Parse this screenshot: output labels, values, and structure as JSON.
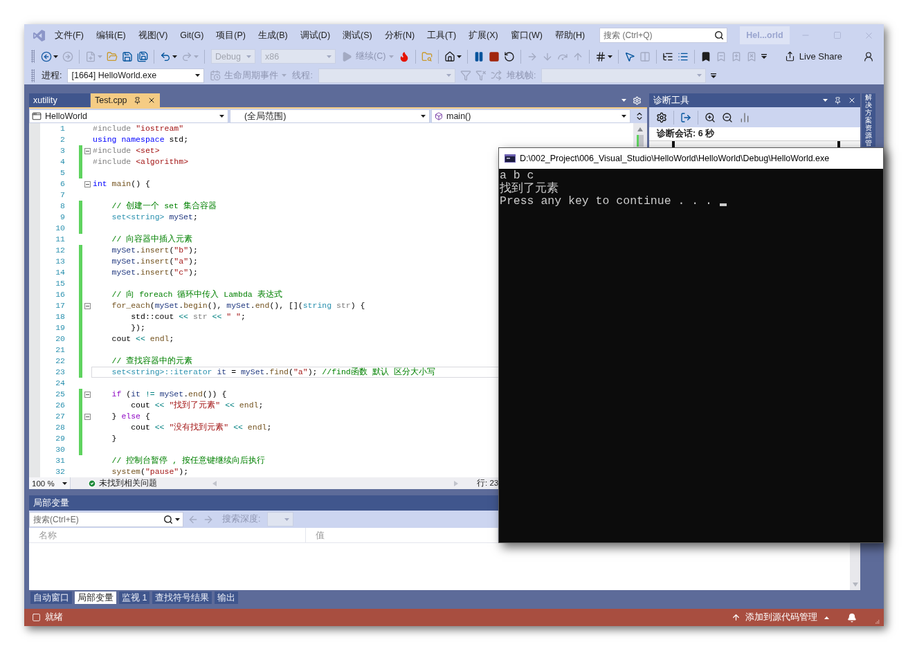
{
  "title_bar": {
    "menu": [
      "文件(F)",
      "编辑(E)",
      "视图(V)",
      "Git(G)",
      "项目(P)",
      "生成(B)",
      "调试(D)",
      "测试(S)",
      "分析(N)",
      "工具(T)",
      "扩展(X)",
      "窗口(W)",
      "帮助(H)"
    ],
    "search": {
      "placeholder": "搜索 (Ctrl+Q)"
    },
    "solution_name": "Hel...orld"
  },
  "toolbar_standard": {
    "groups": [
      {
        "items": [
          {
            "kind": "split",
            "disabled": false
          },
          {
            "kind": "icon",
            "disabled": true
          }
        ]
      },
      {
        "items": [
          {
            "kind": "split",
            "disabled": true
          },
          {
            "kind": "icon",
            "disabled": false
          },
          {
            "kind": "icon",
            "disabled": false
          },
          {
            "kind": "icon",
            "disabled": false
          }
        ]
      },
      {
        "items": [
          {
            "kind": "split",
            "disabled": false
          },
          {
            "kind": "split",
            "disabled": true
          }
        ]
      },
      {
        "items": [
          {
            "kind": "combo",
            "value": "Debug",
            "disabled": true
          },
          {
            "kind": "combo",
            "value": "x86",
            "disabled": true
          },
          {
            "kind": "labeled",
            "label": "继续(C)",
            "disabled": true
          },
          {
            "kind": "icon",
            "disabled": false
          }
        ]
      },
      {
        "items": [
          {
            "kind": "icon",
            "disabled": false
          }
        ]
      },
      {
        "items": [
          {
            "kind": "split",
            "disabled": false
          }
        ]
      },
      {
        "items": [
          {
            "kind": "icon",
            "disabled": false
          },
          {
            "kind": "icon",
            "disabled": false
          },
          {
            "kind": "icon",
            "disabled": false
          }
        ]
      },
      {
        "items": [
          {
            "kind": "icon",
            "disabled": true
          },
          {
            "kind": "icon",
            "disabled": true
          },
          {
            "kind": "icon",
            "disabled": true
          },
          {
            "kind": "icon",
            "disabled": true
          }
        ]
      },
      {
        "items": [
          {
            "kind": "split",
            "disabled": false
          }
        ]
      },
      {
        "items": [
          {
            "kind": "icon",
            "disabled": false
          },
          {
            "kind": "icon",
            "disabled": true
          }
        ]
      },
      {
        "items": [
          {
            "kind": "icon",
            "disabled": false
          },
          {
            "kind": "icon",
            "disabled": false
          }
        ]
      },
      {
        "items": [
          {
            "kind": "icon",
            "disabled": false
          },
          {
            "kind": "icon",
            "disabled": true
          },
          {
            "kind": "icon",
            "disabled": true
          },
          {
            "kind": "icon",
            "disabled": true
          },
          {
            "kind": "overflow"
          }
        ]
      }
    ],
    "live_share": {
      "label": "Live Share"
    }
  },
  "toolbar_debug": {
    "items": [
      {
        "kind": "label",
        "label": "进程:",
        "disabled": false
      },
      {
        "kind": "combo",
        "value": "[1664] HelloWorld.exe",
        "disabled": false
      },
      {
        "kind": "labeled",
        "label": "生命周期事件",
        "disabled": true
      },
      {
        "kind": "label",
        "label": "线程:",
        "disabled": true
      },
      {
        "kind": "combo",
        "disabled": true
      },
      {
        "kind": "icon",
        "disabled": true
      },
      {
        "kind": "icon",
        "disabled": true
      },
      {
        "kind": "icon",
        "disabled": true
      },
      {
        "kind": "label",
        "label": "堆栈帧:",
        "disabled": true
      },
      {
        "kind": "combo",
        "disabled": true
      },
      {
        "kind": "overflow"
      }
    ]
  },
  "document_tabs": [
    {
      "label": "xutility",
      "selected": false
    },
    {
      "label": "Test.cpp",
      "selected": true
    }
  ],
  "editor": {
    "navigation": {
      "project": "HelloWorld",
      "scope": "(全局范围)",
      "member": "main()"
    },
    "lines": [
      {
        "number": "1",
        "modified": false,
        "fold": false,
        "current": false,
        "tokens": [
          {
            "kind": "preproc",
            "text": "#include "
          },
          {
            "kind": "string",
            "text": "\"iostream\""
          }
        ]
      },
      {
        "number": "2",
        "modified": false,
        "fold": false,
        "current": false,
        "tokens": [
          {
            "kind": "keyword",
            "text": "using"
          },
          {
            "kind": "keyword",
            "text": " namespace"
          },
          {
            "kind": "plain",
            "text": " std;"
          }
        ]
      },
      {
        "number": "3",
        "modified": true,
        "fold": true,
        "current": false,
        "tokens": [
          {
            "kind": "preproc",
            "text": "#include "
          },
          {
            "kind": "string",
            "text": "<set>"
          }
        ]
      },
      {
        "number": "4",
        "modified": true,
        "fold": false,
        "current": false,
        "tokens": [
          {
            "kind": "preproc",
            "text": "#include "
          },
          {
            "kind": "string",
            "text": "<algorithm>"
          }
        ]
      },
      {
        "number": "5",
        "modified": true,
        "fold": false,
        "current": false
      },
      {
        "number": "6",
        "modified": false,
        "fold": true,
        "current": false,
        "tokens": [
          {
            "kind": "keyword",
            "text": "int"
          },
          {
            "kind": "function",
            "text": " main"
          },
          {
            "kind": "plain",
            "text": "() {"
          }
        ]
      },
      {
        "number": "7",
        "modified": false,
        "fold": false,
        "current": false
      },
      {
        "number": "8",
        "modified": true,
        "fold": false,
        "current": false,
        "tokens": [
          {
            "kind": "comment",
            "text": "    // 创建一个 set 集合容器"
          }
        ]
      },
      {
        "number": "9",
        "modified": true,
        "fold": false,
        "current": false,
        "tokens": [
          {
            "kind": "type",
            "text": "    set<string>"
          },
          {
            "kind": "variable",
            "text": " mySet"
          },
          {
            "kind": "plain",
            "text": ";"
          }
        ]
      },
      {
        "number": "10",
        "modified": true,
        "fold": false,
        "current": false
      },
      {
        "number": "11",
        "modified": false,
        "fold": false,
        "current": false,
        "tokens": [
          {
            "kind": "comment",
            "text": "    // 向容器中插入元素"
          }
        ]
      },
      {
        "number": "12",
        "modified": true,
        "fold": false,
        "current": false,
        "tokens": [
          {
            "kind": "variable",
            "text": "    mySet"
          },
          {
            "kind": "plain",
            "text": "."
          },
          {
            "kind": "function",
            "text": "insert"
          },
          {
            "kind": "plain",
            "text": "("
          },
          {
            "kind": "string",
            "text": "\"b\""
          },
          {
            "kind": "plain",
            "text": ");"
          }
        ]
      },
      {
        "number": "13",
        "modified": true,
        "fold": false,
        "current": false,
        "tokens": [
          {
            "kind": "variable",
            "text": "    mySet"
          },
          {
            "kind": "plain",
            "text": "."
          },
          {
            "kind": "function",
            "text": "insert"
          },
          {
            "kind": "plain",
            "text": "("
          },
          {
            "kind": "string",
            "text": "\"a\""
          },
          {
            "kind": "plain",
            "text": ");"
          }
        ]
      },
      {
        "number": "14",
        "modified": true,
        "fold": false,
        "current": false,
        "tokens": [
          {
            "kind": "variable",
            "text": "    mySet"
          },
          {
            "kind": "plain",
            "text": "."
          },
          {
            "kind": "function",
            "text": "insert"
          },
          {
            "kind": "plain",
            "text": "("
          },
          {
            "kind": "string",
            "text": "\"c\""
          },
          {
            "kind": "plain",
            "text": ");"
          }
        ]
      },
      {
        "number": "15",
        "modified": true,
        "fold": false,
        "current": false
      },
      {
        "number": "16",
        "modified": true,
        "fold": false,
        "current": false,
        "tokens": [
          {
            "kind": "comment",
            "text": "    // 向 foreach 循环中传入 Lambda 表达式"
          }
        ]
      },
      {
        "number": "17",
        "modified": true,
        "fold": true,
        "current": false,
        "tokens": [
          {
            "kind": "function",
            "text": "    for_each"
          },
          {
            "kind": "plain",
            "text": "("
          },
          {
            "kind": "variable",
            "text": "mySet"
          },
          {
            "kind": "plain",
            "text": "."
          },
          {
            "kind": "function",
            "text": "begin"
          },
          {
            "kind": "plain",
            "text": "(), "
          },
          {
            "kind": "variable",
            "text": "mySet"
          },
          {
            "kind": "plain",
            "text": "."
          },
          {
            "kind": "function",
            "text": "end"
          },
          {
            "kind": "plain",
            "text": "(), []("
          },
          {
            "kind": "type",
            "text": "string"
          },
          {
            "kind": "parameter",
            "text": " str"
          },
          {
            "kind": "plain",
            "text": ") {"
          }
        ]
      },
      {
        "number": "18",
        "modified": true,
        "fold": false,
        "current": false,
        "tokens": [
          {
            "kind": "plain",
            "text": "        std::cout "
          },
          {
            "kind": "operator",
            "text": "<<"
          },
          {
            "kind": "parameter",
            "text": " str"
          },
          {
            "kind": "operator",
            "text": " <<"
          },
          {
            "kind": "string",
            "text": " \" \""
          },
          {
            "kind": "plain",
            "text": ";"
          }
        ]
      },
      {
        "number": "19",
        "modified": true,
        "fold": false,
        "current": false,
        "tokens": [
          {
            "kind": "plain",
            "text": "        });"
          }
        ]
      },
      {
        "number": "20",
        "modified": true,
        "fold": false,
        "current": false,
        "tokens": [
          {
            "kind": "plain",
            "text": "    cout "
          },
          {
            "kind": "operator",
            "text": "<<"
          },
          {
            "kind": "function",
            "text": " endl"
          },
          {
            "kind": "plain",
            "text": ";"
          }
        ]
      },
      {
        "number": "21",
        "modified": true,
        "fold": false,
        "current": false
      },
      {
        "number": "22",
        "modified": true,
        "fold": false,
        "current": false,
        "tokens": [
          {
            "kind": "comment",
            "text": "    // 查找容器中的元素"
          }
        ]
      },
      {
        "number": "23",
        "modified": true,
        "fold": false,
        "current": true,
        "tokens": [
          {
            "kind": "type",
            "text": "    set<string>::iterator"
          },
          {
            "kind": "variable",
            "text": " it"
          },
          {
            "kind": "plain",
            "text": " = "
          },
          {
            "kind": "variable",
            "text": "mySet"
          },
          {
            "kind": "plain",
            "text": "."
          },
          {
            "kind": "function",
            "text": "find"
          },
          {
            "kind": "plain",
            "text": "("
          },
          {
            "kind": "string",
            "text": "\"a\""
          },
          {
            "kind": "plain",
            "text": "); "
          },
          {
            "kind": "comment",
            "text": "//find函数 默认 区分大小写"
          }
        ]
      },
      {
        "number": "24",
        "modified": false,
        "fold": false,
        "current": false
      },
      {
        "number": "25",
        "modified": true,
        "fold": true,
        "current": false,
        "tokens": [
          {
            "kind": "control",
            "text": "    if"
          },
          {
            "kind": "plain",
            "text": " ("
          },
          {
            "kind": "variable",
            "text": "it"
          },
          {
            "kind": "operator",
            "text": " !="
          },
          {
            "kind": "variable",
            "text": " mySet"
          },
          {
            "kind": "plain",
            "text": "."
          },
          {
            "kind": "function",
            "text": "end"
          },
          {
            "kind": "plain",
            "text": "()) {"
          }
        ]
      },
      {
        "number": "26",
        "modified": true,
        "fold": false,
        "current": false,
        "tokens": [
          {
            "kind": "plain",
            "text": "        cout "
          },
          {
            "kind": "operator",
            "text": "<<"
          },
          {
            "kind": "string",
            "text": " \"找到了元素\""
          },
          {
            "kind": "operator",
            "text": " <<"
          },
          {
            "kind": "function",
            "text": " endl"
          },
          {
            "kind": "plain",
            "text": ";"
          }
        ]
      },
      {
        "number": "27",
        "modified": true,
        "fold": true,
        "current": false,
        "tokens": [
          {
            "kind": "plain",
            "text": "    } "
          },
          {
            "kind": "control",
            "text": "else"
          },
          {
            "kind": "plain",
            "text": " {"
          }
        ]
      },
      {
        "number": "28",
        "modified": true,
        "fold": false,
        "current": false,
        "tokens": [
          {
            "kind": "plain",
            "text": "        cout "
          },
          {
            "kind": "operator",
            "text": "<<"
          },
          {
            "kind": "string",
            "text": " \"没有找到元素\""
          },
          {
            "kind": "operator",
            "text": " <<"
          },
          {
            "kind": "function",
            "text": " endl"
          },
          {
            "kind": "plain",
            "text": ";"
          }
        ]
      },
      {
        "number": "29",
        "modified": true,
        "fold": false,
        "current": false,
        "tokens": [
          {
            "kind": "plain",
            "text": "    }"
          }
        ]
      },
      {
        "number": "30",
        "modified": true,
        "fold": false,
        "current": false
      },
      {
        "number": "31",
        "modified": false,
        "fold": false,
        "current": false,
        "tokens": [
          {
            "kind": "comment",
            "text": "    // 控制台暂停 , 按任意键继续向后执行"
          }
        ]
      },
      {
        "number": "32",
        "modified": false,
        "fold": false,
        "current": false,
        "tokens": [
          {
            "kind": "function",
            "text": "    system"
          },
          {
            "kind": "plain",
            "text": "("
          },
          {
            "kind": "string",
            "text": "\"pause\""
          },
          {
            "kind": "plain",
            "text": ");"
          }
        ]
      }
    ],
    "status": {
      "zoom": "100 %",
      "issues": "未找到相关问题",
      "position": "行: 23"
    }
  },
  "diagnostics_panel": {
    "title": "诊断工具",
    "session": "诊断会话: 6 秒"
  },
  "side_tab": {
    "label": "解决方案资源管"
  },
  "locals_panel": {
    "title": "局部变量",
    "search": {
      "placeholder": "搜索(Ctrl+E)"
    },
    "history_buttons": [
      {
        "disabled": true
      },
      {
        "disabled": true
      }
    ],
    "depth": {
      "label": "搜索深度:",
      "disabled": true
    },
    "columns": [
      "名称",
      "值"
    ]
  },
  "bottom_tabs": [
    {
      "label": "自动窗口",
      "selected": false
    },
    {
      "label": "局部变量",
      "selected": true
    },
    {
      "label": "监视 1",
      "selected": false
    },
    {
      "label": "查找符号结果",
      "selected": false
    },
    {
      "label": "输出",
      "selected": false
    }
  ],
  "status_bar": {
    "text": "就绪",
    "source_control": "添加到源代码管理"
  },
  "console": {
    "title": "D:\\002_Project\\006_Visual_Studio\\HelloWorld\\HelloWorld\\Debug\\HelloWorld.exe",
    "lines": [
      "a b c",
      "找到了元素",
      "Press any key to continue . . ."
    ]
  }
}
